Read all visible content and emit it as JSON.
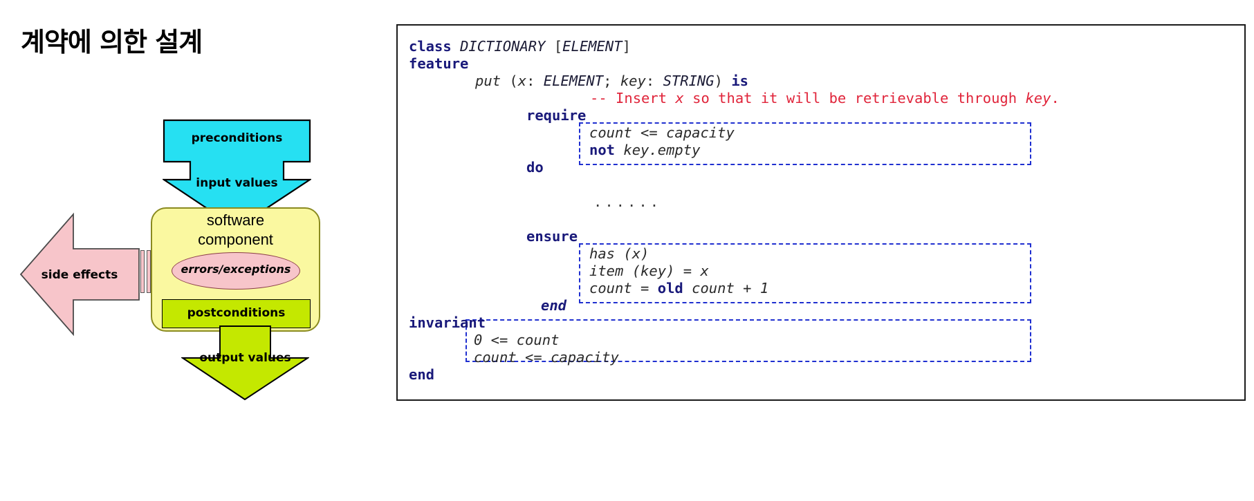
{
  "slide": {
    "title": "계약에 의한 설계"
  },
  "diagram": {
    "name": "design-by-contract-diagram",
    "preconditions_label": "preconditions",
    "input_values_label": "input values",
    "component_label_line1": "software",
    "component_label_line2": "component",
    "errors_label": "errors/exceptions",
    "postconditions_label": "postconditions",
    "output_values_label": "output values",
    "side_effects_label": "side effects",
    "colors": {
      "precondition_arrow": "#26E0F2",
      "component_fill": "#FAF8A0",
      "errors_ellipse": "#F7C5CA",
      "postcondition_bar": "#C4E800",
      "output_arrow": "#C4E800",
      "side_effects_arrow": "#F7C5CA"
    }
  },
  "code": {
    "panel_name": "eiffel-code-panel",
    "colors": {
      "keyword": "#19197a",
      "identifier": "#2a2a2a",
      "comment": "#E0243A",
      "contract_box_border": "#1f2fd0",
      "panel_border": "#1a1a1a"
    },
    "lines": [
      {
        "id": "class-line",
        "text": "class DICTIONARY [ELEMENT]"
      },
      {
        "id": "feature-line",
        "text": "feature"
      },
      {
        "id": "put-signature",
        "text": "put (x: ELEMENT; key: STRING) is"
      },
      {
        "id": "comment-line",
        "text": "-- Insert x so that it will be retrievable through key."
      },
      {
        "id": "require-keyword",
        "text": "require"
      },
      {
        "id": "precond-1",
        "text": "count <= capacity"
      },
      {
        "id": "precond-2",
        "text": "not key.empty"
      },
      {
        "id": "do-keyword",
        "text": "do"
      },
      {
        "id": "body-ellipsis",
        "text": "......"
      },
      {
        "id": "ensure-keyword",
        "text": "ensure"
      },
      {
        "id": "postcond-1",
        "text": "has (x)"
      },
      {
        "id": "postcond-2",
        "text": "item (key) = x"
      },
      {
        "id": "postcond-3",
        "text": "count = old count + 1"
      },
      {
        "id": "routine-end",
        "text": "end"
      },
      {
        "id": "invariant-keyword",
        "text": "invariant"
      },
      {
        "id": "invariant-1",
        "text": "0 <= count"
      },
      {
        "id": "invariant-2",
        "text": "count <= capacity"
      },
      {
        "id": "class-end",
        "text": "end"
      }
    ]
  }
}
